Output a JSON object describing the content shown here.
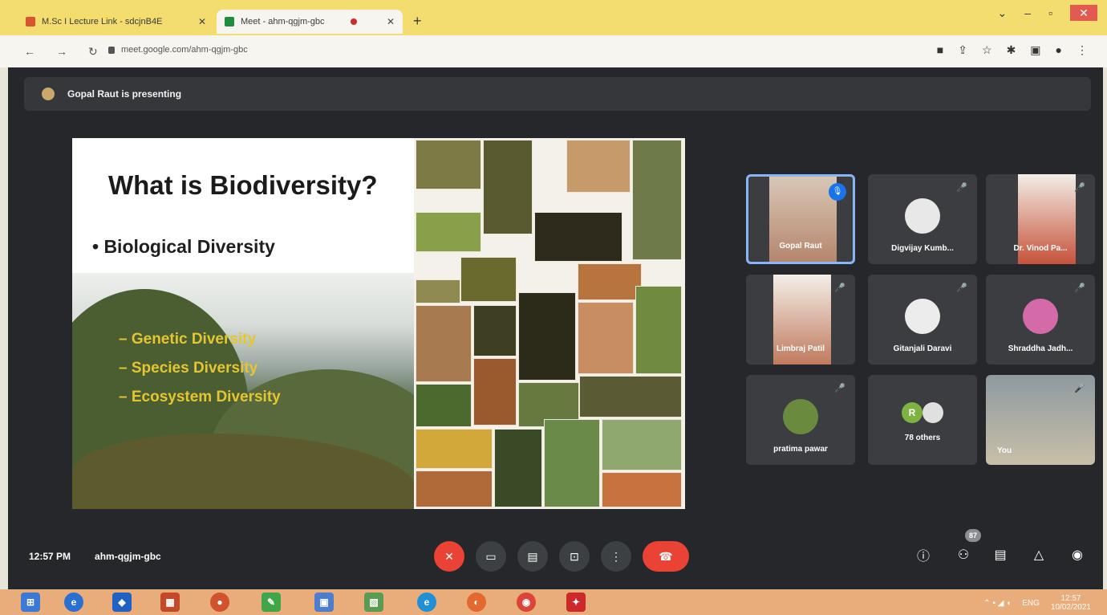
{
  "browser": {
    "tabs": [
      {
        "label": "M.Sc I Lecture Link - sdcjnB4E"
      },
      {
        "label": "Meet - ahm-qgjm-gbc"
      }
    ],
    "new_tab": "+",
    "url": "meet.google.com/ahm-qgjm-gbc",
    "window_buttons": {
      "minimize": "–",
      "restore": "▫",
      "close": "✕"
    }
  },
  "meet": {
    "presenting_text": "Gopal Raut is presenting",
    "slide": {
      "title": "What is Biodiversity?",
      "bullet": "• Biological Diversity",
      "items": [
        "– Genetic Diversity",
        "– Species Diversity",
        "– Ecosystem Diversity"
      ]
    },
    "participants": [
      {
        "name": "Gopal Raut",
        "mic": "🎙",
        "speaking": true
      },
      {
        "name": "Digvijay Kumb...",
        "mic": "🎤"
      },
      {
        "name": "Dr. Vinod Pa...",
        "mic": "🎤"
      },
      {
        "name": "Limbraj Patil",
        "mic": "🎤"
      },
      {
        "name": "Gitanjali Daravi",
        "mic": "🎤"
      },
      {
        "name": "Shraddha Jadh...",
        "mic": "🎤"
      },
      {
        "name": "pratima pawar",
        "mic": "🎤"
      },
      {
        "name": "78 others",
        "avatar_letter": "R"
      },
      {
        "name": "You",
        "mic": "🎤"
      }
    ],
    "time": "12:57 PM",
    "meeting_code": "ahm-qgjm-gbc",
    "participants_count": "87"
  },
  "taskbar": {
    "tray_lang": "ENG",
    "tray_time": "12:57",
    "tray_date": "10/02/2021"
  },
  "colors": {
    "accent": "#1a73e8",
    "end_call": "#ea4335",
    "slide_text_highlight": "#e4c630",
    "tabbar": "#f2dd6e"
  }
}
